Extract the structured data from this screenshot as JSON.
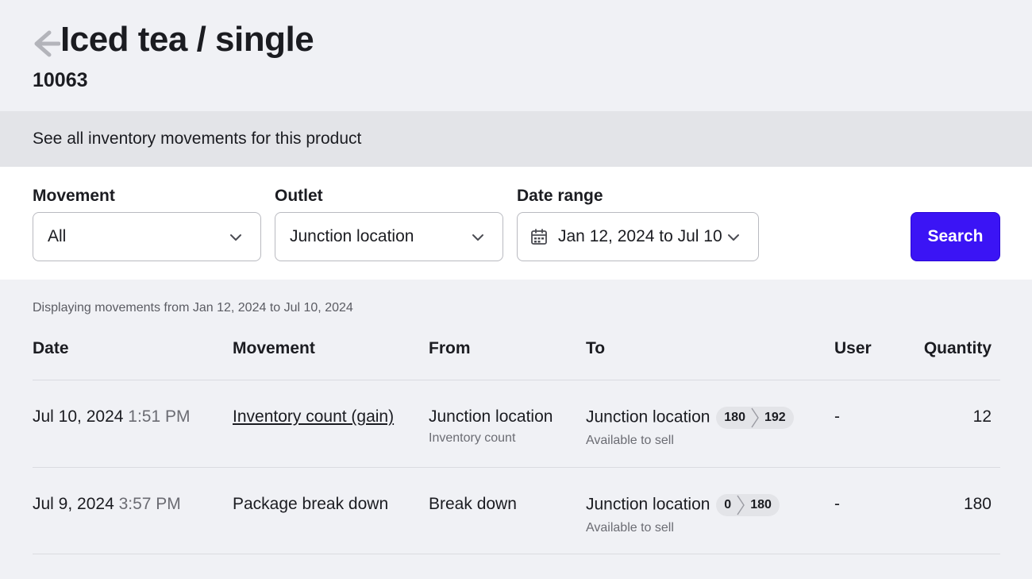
{
  "header": {
    "title": "Iced tea / single",
    "sku": "10063",
    "back_icon": "arrow-left-icon"
  },
  "banner": {
    "text": "See all inventory movements for this product"
  },
  "filters": {
    "movement": {
      "label": "Movement",
      "value": "All"
    },
    "outlet": {
      "label": "Outlet",
      "value": "Junction location"
    },
    "date_range": {
      "label": "Date range",
      "value": "Jan 12, 2024 to Jul 10"
    },
    "search_label": "Search",
    "accent_color": "#3b14f5"
  },
  "results": {
    "range_text": "Displaying movements from Jan 12, 2024 to Jul 10, 2024",
    "columns": [
      "Date",
      "Movement",
      "From",
      "To",
      "User",
      "Quantity"
    ],
    "rows": [
      {
        "date": "Jul 10, 2024",
        "time": "1:51 PM",
        "movement": "Inventory count (gain)",
        "from": "Junction location",
        "from_sub": "Inventory count",
        "to": "Junction location",
        "to_sub": "Available to sell",
        "qty_before": "180",
        "qty_after": "192",
        "user": "-",
        "quantity": "12"
      },
      {
        "date": "Jul 9, 2024",
        "time": "3:57 PM",
        "movement": "Package break down",
        "from": "Break down",
        "to": "Junction location",
        "to_sub": "Available to sell",
        "qty_before": "0",
        "qty_after": "180",
        "user": "-",
        "quantity": "180"
      }
    ]
  }
}
